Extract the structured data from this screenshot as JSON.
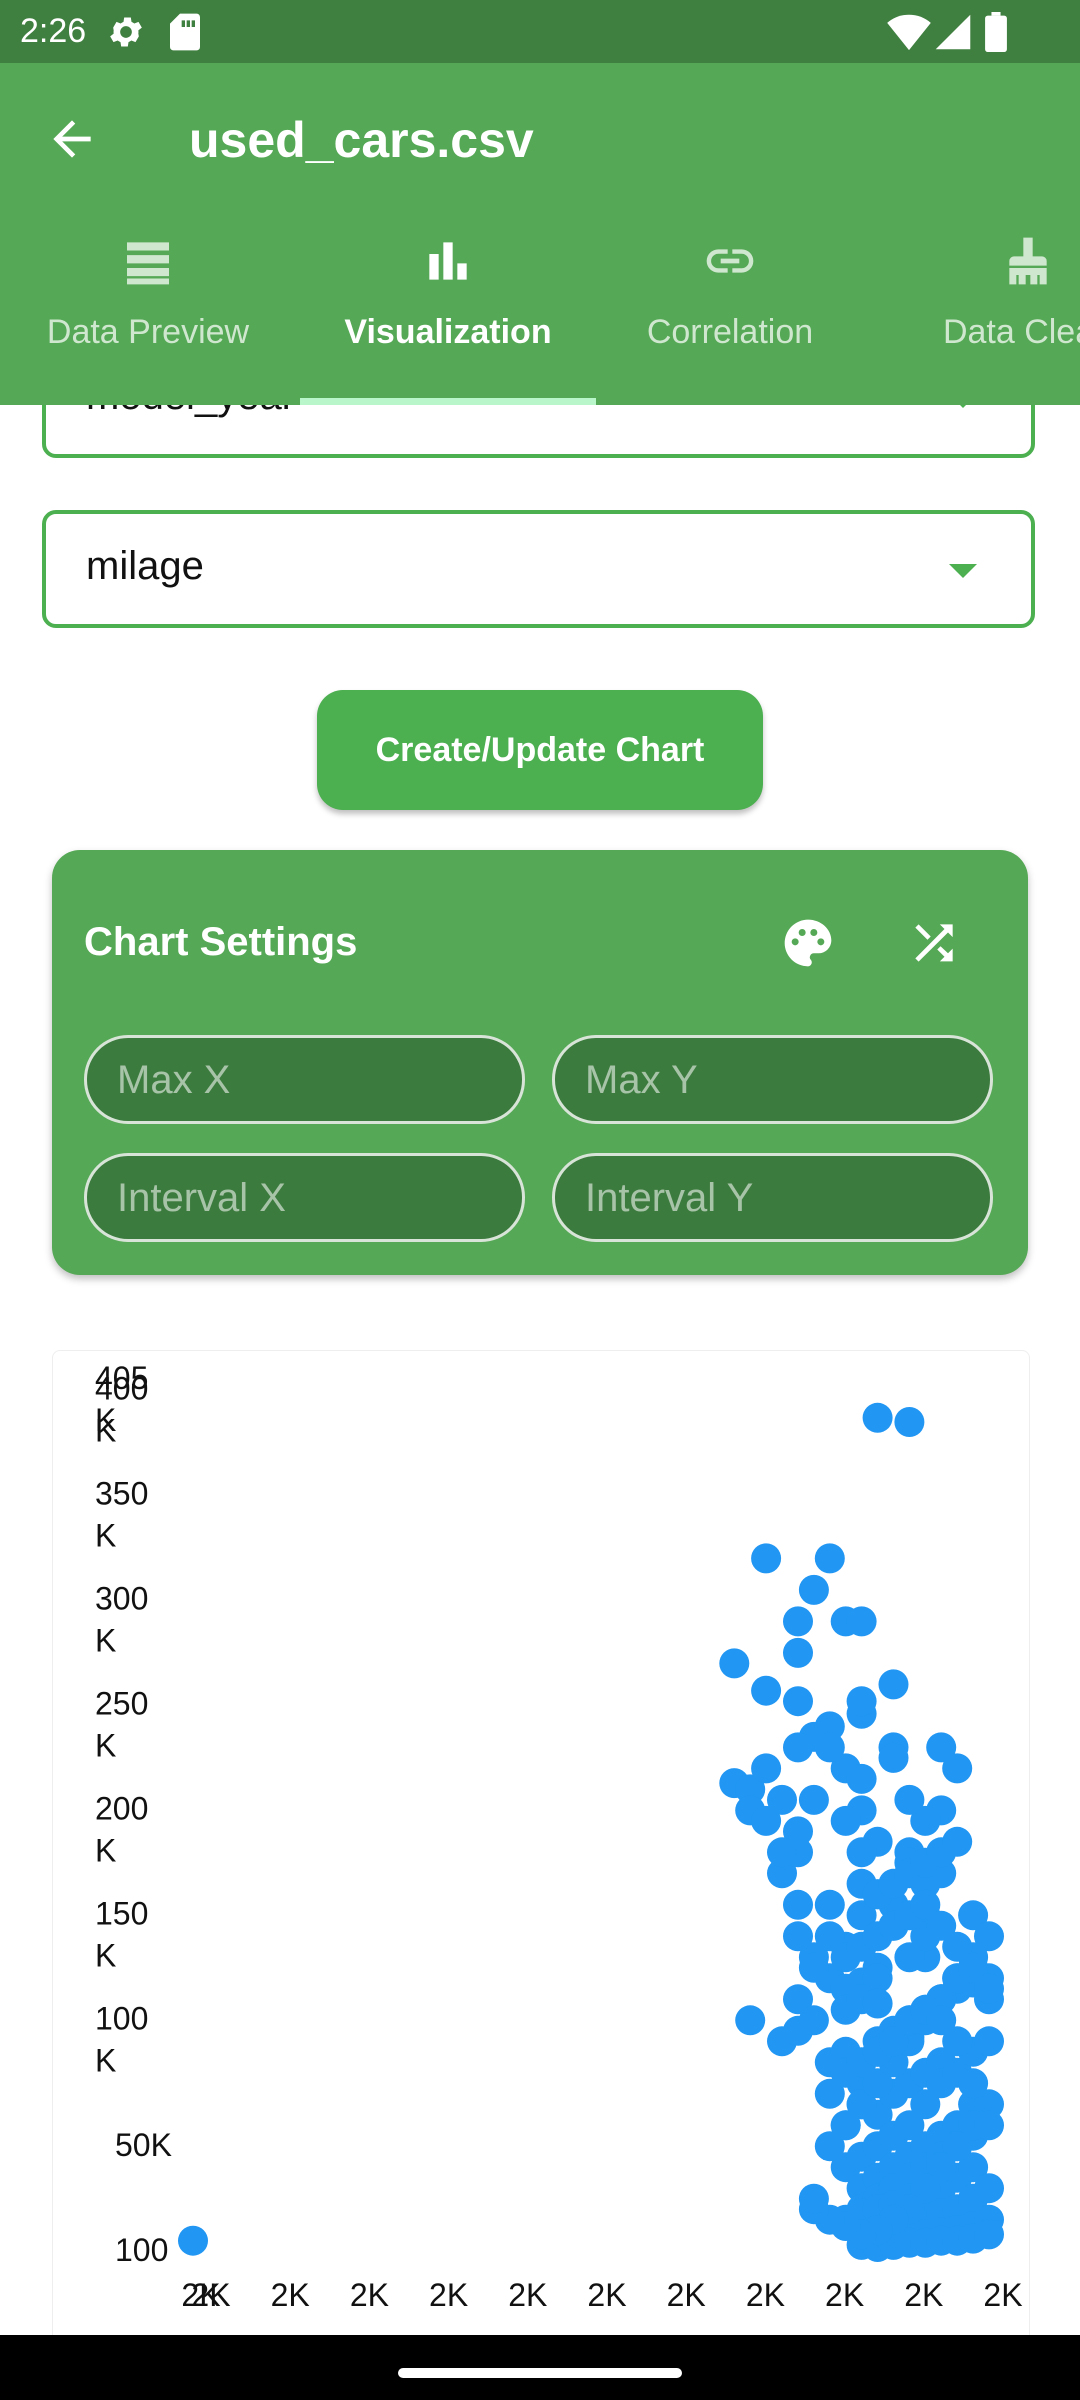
{
  "status_bar": {
    "time": "2:26"
  },
  "app_bar": {
    "title": "used_cars.csv"
  },
  "tabs": [
    {
      "label": "Data Preview",
      "icon": "list-icon"
    },
    {
      "label": "Visualization",
      "icon": "bar-chart-icon"
    },
    {
      "label": "Correlation",
      "icon": "link-icon"
    },
    {
      "label": "Data Clean",
      "icon": "cleaning-brush-icon"
    }
  ],
  "selectors": {
    "x_column": "model_year",
    "y_column": "milage"
  },
  "actions": {
    "create_chart": "Create/Update Chart"
  },
  "chart_settings": {
    "title": "Chart Settings",
    "max_x_placeholder": "Max X",
    "max_y_placeholder": "Max Y",
    "interval_x_placeholder": "Interval X",
    "interval_y_placeholder": "Interval Y"
  },
  "colors": {
    "primary": "#4caf50",
    "app_bar": "#55a855",
    "point": "#2196f3"
  },
  "chart_data": {
    "type": "scatter",
    "y_ticks": [
      "100",
      "50K",
      "100\nK",
      "150\nK",
      "200\nK",
      "250\nK",
      "300\nK",
      "350\nK",
      "400\nK",
      "405\nK"
    ],
    "x_ticks": [
      "2K",
      "2K",
      "2K",
      "2K",
      "2K",
      "2K",
      "2K",
      "2K",
      "2K",
      "2K",
      "2K",
      "2K"
    ],
    "xlim": [
      1974,
      2024
    ],
    "ylim": [
      100,
      405000
    ],
    "series": [
      {
        "x": [
          1974,
          2017,
          2019,
          2010,
          2013,
          2014,
          2012,
          2012,
          2015,
          2016,
          2018,
          2008,
          2021,
          2022,
          2012,
          2010,
          2008,
          2009,
          2013,
          2016,
          2016,
          2018,
          2012,
          2010,
          2009,
          2010,
          2011,
          2015,
          2011,
          2012,
          2016,
          2019,
          2021,
          2014,
          2018,
          2014,
          2013,
          2012,
          2015,
          2012,
          2017,
          2020,
          2020,
          2019,
          2016,
          2011,
          2016,
          2019,
          2021,
          2009,
          2011,
          2012,
          2014,
          2016,
          2012,
          2013,
          2017,
          2016,
          2014,
          2018,
          2013,
          2015,
          2014,
          2012,
          2016,
          2017,
          2017,
          2015,
          2013,
          2015,
          2016,
          2017,
          2018,
          2020,
          2020,
          2014,
          2015,
          2016,
          2017,
          2018,
          2019,
          2019,
          2020,
          2021,
          2022,
          2015,
          2016,
          2017,
          2018,
          2019,
          2020,
          2021,
          2015,
          2016,
          2017,
          2018,
          2019,
          2020,
          2021,
          2022,
          2023,
          2016,
          2017,
          2018,
          2019,
          2020,
          2021,
          2022,
          2023,
          2016,
          2017,
          2018,
          2019,
          2020,
          2021,
          2022,
          2023,
          2023,
          2015,
          2016,
          2017,
          2018,
          2019,
          2020,
          2021,
          2022,
          2023,
          2016,
          2017,
          2018,
          2019,
          2020,
          2021,
          2022,
          2023,
          2024,
          2017,
          2018,
          2019,
          2020,
          2021,
          2022,
          2023,
          2024,
          2016,
          2017,
          2018,
          2019,
          2020,
          2021,
          2022,
          2023,
          2024,
          2017,
          2018,
          2019,
          2020,
          2021,
          2022,
          2023,
          2024,
          2017,
          2018,
          2019,
          2020,
          2021,
          2022,
          2023,
          2024,
          2014,
          2015,
          2016,
          2017,
          2018,
          2019,
          2020,
          2021,
          2022,
          2023,
          2024,
          2024,
          2024,
          2023,
          2022,
          2021,
          2020,
          2019,
          2018,
          2017,
          2016,
          2015,
          2014,
          2013,
          2013,
          2014,
          2015,
          2016,
          2017,
          2018,
          2019,
          2020,
          2021,
          2022,
          2023,
          2024,
          2015,
          2016,
          2017,
          2018,
          2019,
          2020,
          2021,
          2022,
          2023,
          2024
        ],
        "y": [
          5000,
          397000,
          395000,
          330000,
          315000,
          330000,
          300000,
          285000,
          300000,
          300000,
          270000,
          280000,
          240000,
          230000,
          262000,
          267000,
          223000,
          220000,
          245000,
          256000,
          262000,
          240000,
          240000,
          230000,
          210000,
          205000,
          215000,
          230000,
          180000,
          190000,
          210000,
          190000,
          210000,
          250000,
          235000,
          240000,
          215000,
          200000,
          205000,
          165000,
          195000,
          175000,
          205000,
          215000,
          225000,
          190000,
          190000,
          185000,
          180000,
          110000,
          100000,
          105000,
          130000,
          175000,
          120000,
          140000,
          135000,
          160000,
          165000,
          155000,
          135000,
          145000,
          150000,
          150000,
          128000,
          130000,
          170000,
          125000,
          110000,
          115000,
          120000,
          118000,
          165000,
          160000,
          140000,
          90000,
          95000,
          80000,
          95000,
          100000,
          102000,
          140000,
          150000,
          120000,
          130000,
          60000,
          70000,
          65000,
          75000,
          80000,
          85000,
          90000,
          40000,
          45000,
          50000,
          55000,
          60000,
          70000,
          80000,
          85000,
          95000,
          30000,
          35000,
          40000,
          45000,
          50000,
          55000,
          60000,
          70000,
          20000,
          25000,
          30000,
          35000,
          40000,
          45000,
          50000,
          55000,
          60000,
          15000,
          18000,
          20000,
          22000,
          25000,
          28000,
          30000,
          35000,
          40000,
          8000,
          10000,
          12000,
          14000,
          16000,
          18000,
          20000,
          25000,
          30000,
          5000,
          6000,
          7000,
          8000,
          9000,
          10000,
          12000,
          15000,
          3000,
          2000,
          3000,
          4000,
          4000,
          5000,
          5000,
          6000,
          8000,
          100000,
          105000,
          110000,
          115000,
          120000,
          125000,
          128000,
          130000,
          170000,
          175000,
          180000,
          185000,
          190000,
          195000,
          160000,
          150000,
          50000,
          60000,
          70000,
          80000,
          90000,
          100000,
          110000,
          120000,
          130000,
          140000,
          100000,
          120000,
          70000,
          60000,
          50000,
          40000,
          30000,
          20000,
          15000,
          10000,
          8000,
          12000,
          15000,
          20000,
          25000,
          75000,
          85000,
          90000,
          95000,
          100000,
          110000,
          115000,
          110000,
          100000,
          80000,
          60000,
          140000,
          145000,
          150000,
          155000,
          160000,
          165000,
          155000,
          145000,
          135000,
          125000
        ]
      }
    ]
  }
}
